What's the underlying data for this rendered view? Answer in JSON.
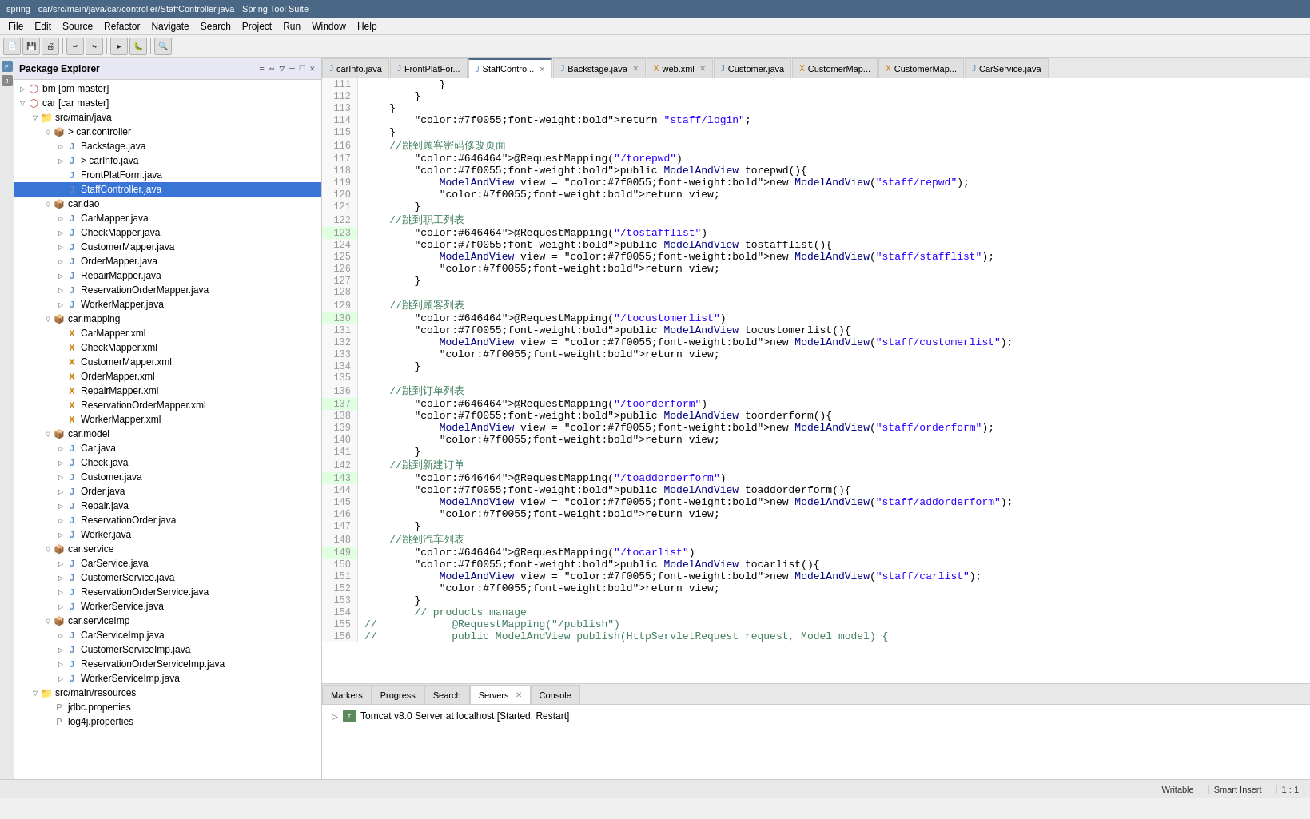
{
  "titlebar": {
    "text": "spring - car/src/main/java/car/controller/StaffController.java - Spring Tool Suite"
  },
  "menubar": {
    "items": [
      "File",
      "Edit",
      "Source",
      "Refactor",
      "Navigate",
      "Search",
      "Project",
      "Run",
      "Window",
      "Help"
    ]
  },
  "package_explorer": {
    "title": "Package Explorer",
    "tree": [
      {
        "id": "bm",
        "label": "bm  [bm master]",
        "indent": 0,
        "type": "project",
        "arrow": "▷"
      },
      {
        "id": "car",
        "label": "car  [car master]",
        "indent": 0,
        "type": "project",
        "arrow": "▽"
      },
      {
        "id": "src-main-java",
        "label": "src/main/java",
        "indent": 1,
        "type": "folder",
        "arrow": "▽"
      },
      {
        "id": "car-controller",
        "label": "> car.controller",
        "indent": 2,
        "type": "package",
        "arrow": "▽"
      },
      {
        "id": "backstage",
        "label": "Backstage.java",
        "indent": 3,
        "type": "java",
        "arrow": "▷"
      },
      {
        "id": "carinfo",
        "label": "> carInfo.java",
        "indent": 3,
        "type": "java",
        "arrow": "▷"
      },
      {
        "id": "frontplatform",
        "label": "FrontPlatForm.java",
        "indent": 3,
        "type": "java",
        "arrow": ""
      },
      {
        "id": "staffcontroller",
        "label": "StaffController.java",
        "indent": 3,
        "type": "java",
        "arrow": "",
        "selected": true
      },
      {
        "id": "car-dao",
        "label": "car.dao",
        "indent": 2,
        "type": "package",
        "arrow": "▽"
      },
      {
        "id": "carmapper",
        "label": "CarMapper.java",
        "indent": 3,
        "type": "java",
        "arrow": "▷"
      },
      {
        "id": "checkmapper",
        "label": "CheckMapper.java",
        "indent": 3,
        "type": "java",
        "arrow": "▷"
      },
      {
        "id": "customermapper",
        "label": "CustomerMapper.java",
        "indent": 3,
        "type": "java",
        "arrow": "▷"
      },
      {
        "id": "ordermapper",
        "label": "OrderMapper.java",
        "indent": 3,
        "type": "java",
        "arrow": "▷"
      },
      {
        "id": "repairmapper",
        "label": "RepairMapper.java",
        "indent": 3,
        "type": "java",
        "arrow": "▷"
      },
      {
        "id": "reservationordermapper",
        "label": "ReservationOrderMapper.java",
        "indent": 3,
        "type": "java",
        "arrow": "▷"
      },
      {
        "id": "workermapper",
        "label": "WorkerMapper.java",
        "indent": 3,
        "type": "java",
        "arrow": "▷"
      },
      {
        "id": "car-mapping",
        "label": "car.mapping",
        "indent": 2,
        "type": "package",
        "arrow": "▽"
      },
      {
        "id": "carmapper-xml",
        "label": "CarMapper.xml",
        "indent": 3,
        "type": "xml",
        "arrow": ""
      },
      {
        "id": "checkmapper-xml",
        "label": "CheckMapper.xml",
        "indent": 3,
        "type": "xml",
        "arrow": ""
      },
      {
        "id": "customermapper-xml",
        "label": "CustomerMapper.xml",
        "indent": 3,
        "type": "xml",
        "arrow": ""
      },
      {
        "id": "ordermapper-xml",
        "label": "OrderMapper.xml",
        "indent": 3,
        "type": "xml",
        "arrow": ""
      },
      {
        "id": "repairmapper-xml",
        "label": "RepairMapper.xml",
        "indent": 3,
        "type": "xml",
        "arrow": ""
      },
      {
        "id": "reservationordermapper-xml",
        "label": "ReservationOrderMapper.xml",
        "indent": 3,
        "type": "xml",
        "arrow": ""
      },
      {
        "id": "workermapper-xml",
        "label": "WorkerMapper.xml",
        "indent": 3,
        "type": "xml",
        "arrow": ""
      },
      {
        "id": "car-model",
        "label": "car.model",
        "indent": 2,
        "type": "package",
        "arrow": "▽"
      },
      {
        "id": "car-java",
        "label": "Car.java",
        "indent": 3,
        "type": "java",
        "arrow": "▷"
      },
      {
        "id": "check-java",
        "label": "Check.java",
        "indent": 3,
        "type": "java",
        "arrow": "▷"
      },
      {
        "id": "customer-java",
        "label": "Customer.java",
        "indent": 3,
        "type": "java",
        "arrow": "▷"
      },
      {
        "id": "order-java",
        "label": "Order.java",
        "indent": 3,
        "type": "java",
        "arrow": "▷"
      },
      {
        "id": "repair-java",
        "label": "Repair.java",
        "indent": 3,
        "type": "java",
        "arrow": "▷"
      },
      {
        "id": "reservationorder-java",
        "label": "ReservationOrder.java",
        "indent": 3,
        "type": "java",
        "arrow": "▷"
      },
      {
        "id": "worker-java",
        "label": "Worker.java",
        "indent": 3,
        "type": "java",
        "arrow": "▷"
      },
      {
        "id": "car-service",
        "label": "car.service",
        "indent": 2,
        "type": "package",
        "arrow": "▽"
      },
      {
        "id": "carservice-java",
        "label": "CarService.java",
        "indent": 3,
        "type": "java",
        "arrow": "▷"
      },
      {
        "id": "customerservice-java",
        "label": "CustomerService.java",
        "indent": 3,
        "type": "java",
        "arrow": "▷"
      },
      {
        "id": "reservationorderservice-java",
        "label": "ReservationOrderService.java",
        "indent": 3,
        "type": "java",
        "arrow": "▷"
      },
      {
        "id": "workerservice-java",
        "label": "WorkerService.java",
        "indent": 3,
        "type": "java",
        "arrow": "▷"
      },
      {
        "id": "car-serviceimp",
        "label": "car.serviceImp",
        "indent": 2,
        "type": "package",
        "arrow": "▽"
      },
      {
        "id": "carserviceimp-java",
        "label": "CarServiceImp.java",
        "indent": 3,
        "type": "java",
        "arrow": "▷"
      },
      {
        "id": "customerserviceimp-java",
        "label": "CustomerServiceImp.java",
        "indent": 3,
        "type": "java",
        "arrow": "▷"
      },
      {
        "id": "reservationorderserviceimp-java",
        "label": "ReservationOrderServiceImp.java",
        "indent": 3,
        "type": "java",
        "arrow": "▷"
      },
      {
        "id": "workerserviceimp-java",
        "label": "WorkerServiceImp.java",
        "indent": 3,
        "type": "java",
        "arrow": "▷"
      },
      {
        "id": "src-main-resources",
        "label": "src/main/resources",
        "indent": 1,
        "type": "folder",
        "arrow": "▽"
      },
      {
        "id": "jdbc-properties",
        "label": "jdbc.properties",
        "indent": 2,
        "type": "properties",
        "arrow": ""
      },
      {
        "id": "log4j-properties",
        "label": "log4j.properties",
        "indent": 2,
        "type": "properties",
        "arrow": ""
      }
    ]
  },
  "editor_tabs": [
    {
      "id": "carinfo",
      "label": "carInfo.java",
      "type": "java",
      "active": false,
      "closeable": false
    },
    {
      "id": "frontplatform",
      "label": "FrontPlatFor...",
      "type": "java",
      "active": false,
      "closeable": false
    },
    {
      "id": "staffcontroller",
      "label": "StaffContro...",
      "type": "java",
      "active": true,
      "closeable": true
    },
    {
      "id": "backstage",
      "label": "Backstage.java",
      "type": "java",
      "active": false,
      "closeable": true
    },
    {
      "id": "webxml",
      "label": "web.xml",
      "type": "xml",
      "active": false,
      "closeable": true
    },
    {
      "id": "customer",
      "label": "Customer.java",
      "type": "java",
      "active": false,
      "closeable": false
    },
    {
      "id": "customermapper1",
      "label": "CustomerMap...",
      "type": "xml",
      "active": false,
      "closeable": false
    },
    {
      "id": "customermapper2",
      "label": "CustomerMap...",
      "type": "xml",
      "active": false,
      "closeable": false
    },
    {
      "id": "carservice",
      "label": "CarService.java",
      "type": "java",
      "active": false,
      "closeable": false
    }
  ],
  "code": {
    "lines": [
      {
        "num": 111,
        "content": "            }"
      },
      {
        "num": 112,
        "content": "        }"
      },
      {
        "num": 113,
        "content": "    }"
      },
      {
        "num": 114,
        "content": "        return \"staff/login\";"
      },
      {
        "num": 115,
        "content": "    }"
      },
      {
        "num": 116,
        "content": "    //跳到顾客密码修改页面",
        "type": "comment"
      },
      {
        "num": 117,
        "content": "        @RequestMapping(\"/torepwd\")",
        "type": "annotation"
      },
      {
        "num": 118,
        "content": "        public ModelAndView torepwd(){"
      },
      {
        "num": 119,
        "content": "            ModelAndView view = new ModelAndView(\"staff/repwd\");"
      },
      {
        "num": 120,
        "content": "            return view;"
      },
      {
        "num": 121,
        "content": "        }"
      },
      {
        "num": 122,
        "content": "    //跳到职工列表",
        "type": "comment"
      },
      {
        "num": 123,
        "content": "        @RequestMapping(\"/tostafflist\")",
        "type": "annotation",
        "marker": true
      },
      {
        "num": 124,
        "content": "        public ModelAndView tostafflist(){"
      },
      {
        "num": 125,
        "content": "            ModelAndView view = new ModelAndView(\"staff/stafflist\");"
      },
      {
        "num": 126,
        "content": "            return view;"
      },
      {
        "num": 127,
        "content": "        }"
      },
      {
        "num": 128,
        "content": ""
      },
      {
        "num": 129,
        "content": "    //跳到顾客列表",
        "type": "comment"
      },
      {
        "num": 130,
        "content": "        @RequestMapping(\"/tocustomerlist\")",
        "type": "annotation",
        "marker": true
      },
      {
        "num": 131,
        "content": "        public ModelAndView tocustomerlist(){"
      },
      {
        "num": 132,
        "content": "            ModelAndView view = new ModelAndView(\"staff/customerlist\");"
      },
      {
        "num": 133,
        "content": "            return view;"
      },
      {
        "num": 134,
        "content": "        }"
      },
      {
        "num": 135,
        "content": ""
      },
      {
        "num": 136,
        "content": "    //跳到订单列表",
        "type": "comment"
      },
      {
        "num": 137,
        "content": "        @RequestMapping(\"/toorderform\")",
        "type": "annotation",
        "marker": true
      },
      {
        "num": 138,
        "content": "        public ModelAndView toorderform(){"
      },
      {
        "num": 139,
        "content": "            ModelAndView view = new ModelAndView(\"staff/orderform\");"
      },
      {
        "num": 140,
        "content": "            return view;"
      },
      {
        "num": 141,
        "content": "        }"
      },
      {
        "num": 142,
        "content": "    //跳到新建订单",
        "type": "comment"
      },
      {
        "num": 143,
        "content": "        @RequestMapping(\"/toaddorderform\")",
        "type": "annotation",
        "marker": true
      },
      {
        "num": 144,
        "content": "        public ModelAndView toaddorderform(){"
      },
      {
        "num": 145,
        "content": "            ModelAndView view = new ModelAndView(\"staff/addorderform\");"
      },
      {
        "num": 146,
        "content": "            return view;"
      },
      {
        "num": 147,
        "content": "        }"
      },
      {
        "num": 148,
        "content": "    //跳到汽车列表",
        "type": "comment"
      },
      {
        "num": 149,
        "content": "        @RequestMapping(\"/tocarlist\")",
        "type": "annotation",
        "marker": true
      },
      {
        "num": 150,
        "content": "        public ModelAndView tocarlist(){"
      },
      {
        "num": 151,
        "content": "            ModelAndView view = new ModelAndView(\"staff/carlist\");"
      },
      {
        "num": 152,
        "content": "            return view;"
      },
      {
        "num": 153,
        "content": "        }"
      },
      {
        "num": 154,
        "content": "        // products manage",
        "type": "comment_en"
      },
      {
        "num": 155,
        "content": "//            @RequestMapping(\"/publish\")",
        "type": "comment_en"
      },
      {
        "num": 156,
        "content": "//            public ModelAndView publish(HttpServletRequest request, Model model) {",
        "type": "comment_en"
      }
    ]
  },
  "bottom_tabs": [
    {
      "id": "markers",
      "label": "Markers",
      "active": false
    },
    {
      "id": "progress",
      "label": "Progress",
      "active": false
    },
    {
      "id": "search",
      "label": "Search",
      "active": false
    },
    {
      "id": "servers",
      "label": "Servers",
      "active": true,
      "closeable": true
    },
    {
      "id": "console",
      "label": "Console",
      "active": false
    }
  ],
  "servers": [
    {
      "label": "Tomcat v8.0 Server at localhost  [Started, Restart]",
      "status": "started"
    }
  ],
  "statusbar": {
    "writable": "Writable",
    "smart_insert": "Smart Insert",
    "position": "1 : 1"
  },
  "search_bar": {
    "label": "Search"
  }
}
